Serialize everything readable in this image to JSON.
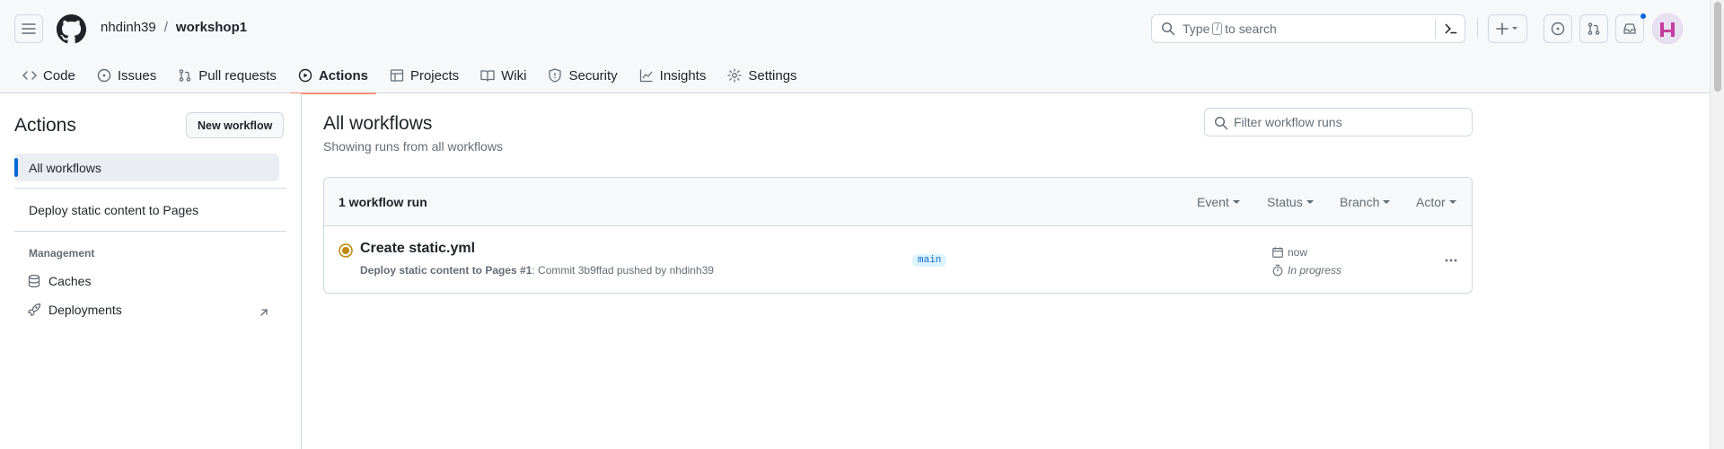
{
  "header": {
    "owner": "nhdinh39",
    "separator": "/",
    "repo": "workshop1",
    "search_placeholder_before": "Type",
    "search_key": "/",
    "search_placeholder_after": "to search"
  },
  "tabs": [
    {
      "label": "Code",
      "icon": "code-icon"
    },
    {
      "label": "Issues",
      "icon": "issue-opened-icon"
    },
    {
      "label": "Pull requests",
      "icon": "git-pull-request-icon"
    },
    {
      "label": "Actions",
      "icon": "play-icon",
      "selected": true
    },
    {
      "label": "Projects",
      "icon": "table-icon"
    },
    {
      "label": "Wiki",
      "icon": "book-icon"
    },
    {
      "label": "Security",
      "icon": "shield-icon"
    },
    {
      "label": "Insights",
      "icon": "graph-icon"
    },
    {
      "label": "Settings",
      "icon": "gear-icon"
    }
  ],
  "sidebar": {
    "title": "Actions",
    "new_workflow": "New workflow",
    "all_workflows": "All workflows",
    "workflow_item": "Deploy static content to Pages",
    "management_heading": "Management",
    "caches": "Caches",
    "deployments": "Deployments"
  },
  "main": {
    "title": "All workflows",
    "subtitle": "Showing runs from all workflows",
    "filter_placeholder": "Filter workflow runs",
    "runs_count": "1 workflow run",
    "filters": [
      "Event",
      "Status",
      "Branch",
      "Actor"
    ]
  },
  "run": {
    "title": "Create static.yml",
    "workflow": "Deploy static content to Pages #1",
    "meta": ": Commit 3b9ffad pushed by nhdinh39",
    "branch": "main",
    "time": "now",
    "duration": "In progress",
    "status_color": "#bf8700"
  },
  "colors": {
    "accent": "#0969da",
    "tab_underline": "#fd8c73"
  }
}
